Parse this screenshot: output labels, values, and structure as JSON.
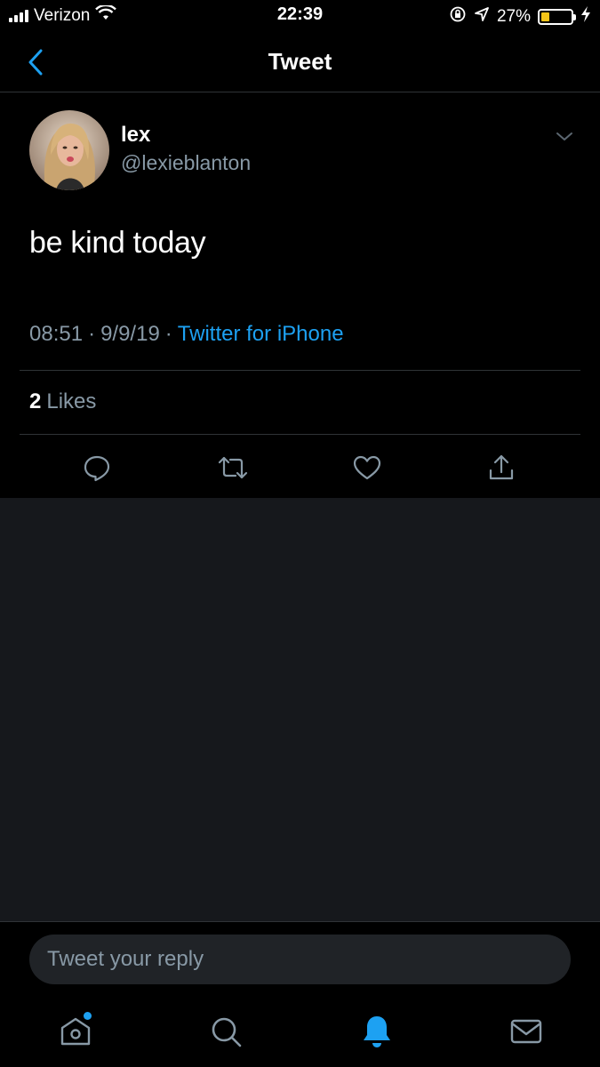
{
  "status_bar": {
    "carrier": "Verizon",
    "time": "22:39",
    "battery_percent": "27%",
    "battery_level": 0.27,
    "icons": [
      "signal-icon",
      "wifi-icon",
      "orientation-lock-icon",
      "location-icon",
      "battery-icon",
      "charging-icon"
    ]
  },
  "nav": {
    "title": "Tweet",
    "back_icon": "chevron-left-icon"
  },
  "tweet": {
    "author_name": "lex",
    "author_handle": "@lexieblanton",
    "text": "be kind today",
    "time": "08:51",
    "separator": "·",
    "date": "9/9/19",
    "source": "Twitter for iPhone",
    "likes_count": "2",
    "likes_label": "Likes",
    "actions": [
      "reply-icon",
      "retweet-icon",
      "like-icon",
      "share-icon"
    ]
  },
  "reply": {
    "placeholder": "Tweet your reply"
  },
  "tabs": [
    "home-icon",
    "search-icon",
    "notifications-icon",
    "messages-icon"
  ],
  "colors": {
    "accent": "#1da1f2",
    "background": "#000000",
    "secondary_background": "#16181c",
    "muted_text": "#8899a6",
    "battery_fill": "#f5c518"
  }
}
